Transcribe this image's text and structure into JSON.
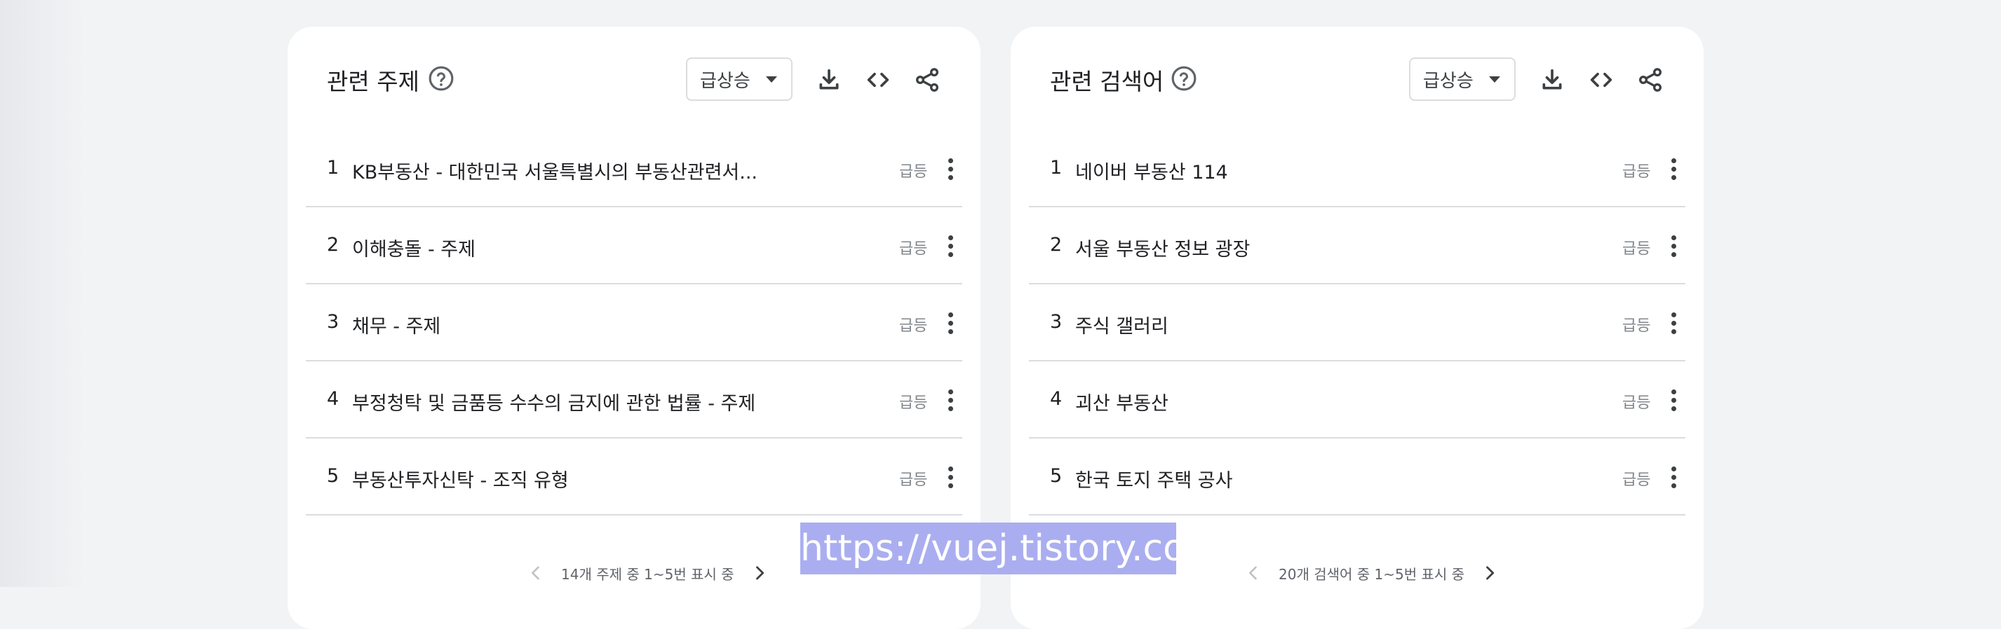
{
  "watermark": "https://vuej.tistory.com",
  "related_topics": {
    "title": "관련 주제",
    "filter_label": "급상승",
    "rows": [
      {
        "num": "1",
        "label": "KB부동산 - 대한민국 서울특별시의 부동산관련서...",
        "badge": "급등"
      },
      {
        "num": "2",
        "label": "이해충돌 - 주제",
        "badge": "급등"
      },
      {
        "num": "3",
        "label": "채무 - 주제",
        "badge": "급등"
      },
      {
        "num": "4",
        "label": "부정청탁 및 금품등 수수의 금지에 관한 법률 - 주제",
        "badge": "급등"
      },
      {
        "num": "5",
        "label": "부동산투자신탁 - 조직 유형",
        "badge": "급등"
      }
    ],
    "pagination": "14개 주제 중 1~5번 표시 중"
  },
  "related_queries": {
    "title": "관련 검색어",
    "filter_label": "급상승",
    "rows": [
      {
        "num": "1",
        "label": "네이버 부동산 114",
        "badge": "급등"
      },
      {
        "num": "2",
        "label": "서울 부동산 정보 광장",
        "badge": "급등"
      },
      {
        "num": "3",
        "label": "주식 갤러리",
        "badge": "급등"
      },
      {
        "num": "4",
        "label": "괴산 부동산",
        "badge": "급등"
      },
      {
        "num": "5",
        "label": "한국 토지 주택 공사",
        "badge": "급등"
      }
    ],
    "pagination": "20개 검색어 중 1~5번 표시 중"
  },
  "colors": {
    "page_bg": "#f1f3f5",
    "card_bg": "#ffffff",
    "divider": "#dadce0",
    "badge": "#80868b",
    "watermark_bg": "#aaaef0"
  },
  "icons": [
    "help-icon",
    "download-icon",
    "embed-code-icon",
    "share-icon",
    "more-vert-icon",
    "chevron-left-icon",
    "chevron-right-icon"
  ]
}
